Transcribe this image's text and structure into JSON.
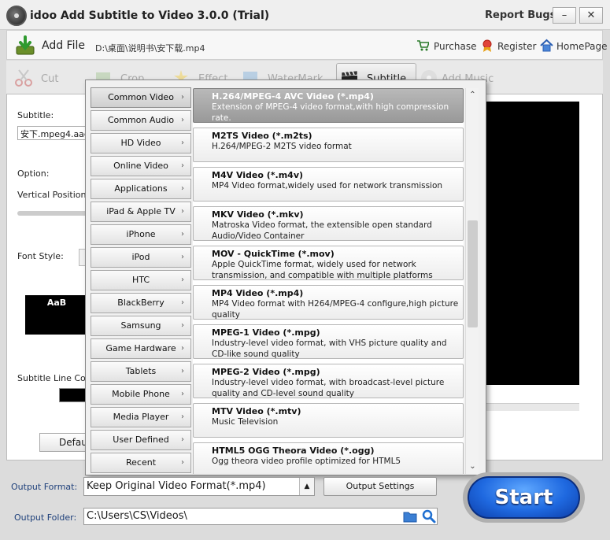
{
  "app": {
    "title": "idoo Add Subtitle to Video 3.0.0 (Trial)",
    "report_bugs": "Report Bugs",
    "minimize": "–",
    "close": "✕"
  },
  "toolbar": {
    "add_file": "Add File",
    "file_path": "D:\\桌面\\说明书\\安下载.mp4",
    "purchase": "Purchase",
    "register": "Register",
    "homepage": "HomePage"
  },
  "tabs": [
    {
      "label": "Cut",
      "icon": "scissors-icon"
    },
    {
      "label": "Crop",
      "icon": "crop-icon"
    },
    {
      "label": "Effect",
      "icon": "effect-icon"
    },
    {
      "label": "WaterMark",
      "icon": "watermark-icon"
    },
    {
      "label": "Subtitle",
      "icon": "clapperboard-icon"
    },
    {
      "label": "Add Music",
      "icon": "music-disc-icon"
    }
  ],
  "left_panel": {
    "subtitle_label": "Subtitle:",
    "subtitle_value": "安下.mpeg4.aac",
    "option_label": "Option:",
    "vertical_position_label": "Vertical Position:",
    "font_style_label": "Font Style:",
    "font_sample": "AaB",
    "line_color_label": "Subtitle Line Color",
    "default_button": "Default"
  },
  "categories": [
    "Common Video",
    "Common Audio",
    "HD Video",
    "Online Video",
    "Applications",
    "iPad & Apple TV",
    "iPhone",
    "iPod",
    "HTC",
    "BlackBerry",
    "Samsung",
    "Game Hardware",
    "Tablets",
    "Mobile Phone",
    "Media Player",
    "User Defined",
    "Recent"
  ],
  "formats": [
    {
      "title": "H.264/MPEG-4 AVC Video (*.mp4)",
      "desc": "Extension of MPEG-4 video format,with high compression rate."
    },
    {
      "title": "M2TS Video (*.m2ts)",
      "desc": "H.264/MPEG-2 M2TS video format"
    },
    {
      "title": "M4V Video (*.m4v)",
      "desc": "MP4 Video format,widely used for network transmission"
    },
    {
      "title": "MKV Video (*.mkv)",
      "desc": "Matroska Video format, the extensible open standard Audio/Video Container"
    },
    {
      "title": "MOV - QuickTime (*.mov)",
      "desc": "Apple QuickTime format, widely used for network transmission, and compatible with multiple platforms"
    },
    {
      "title": "MP4 Video (*.mp4)",
      "desc": "MP4 Video format with H264/MPEG-4 configure,high picture quality"
    },
    {
      "title": "MPEG-1 Video (*.mpg)",
      "desc": "Industry-level video format, with VHS picture quality and CD-like sound quality"
    },
    {
      "title": "MPEG-2 Video (*.mpg)",
      "desc": "Industry-level video format, with broadcast-level picture quality and CD-level sound quality"
    },
    {
      "title": "MTV Video (*.mtv)",
      "desc": "Music Television"
    },
    {
      "title": "HTML5 OGG Theora Video (*.ogg)",
      "desc": "Ogg theora video profile optimized for HTML5"
    }
  ],
  "bottom": {
    "output_format_label": "Output Format:",
    "output_format_value": "Keep Original Video Format(*.mp4)",
    "output_settings": "Output Settings",
    "output_folder_label": "Output Folder:",
    "output_folder_value": "C:\\Users\\CS\\Videos\\",
    "start": "Start"
  },
  "colors": {
    "accent": "#1f69e0",
    "selected_format": "#a5a5a5"
  }
}
